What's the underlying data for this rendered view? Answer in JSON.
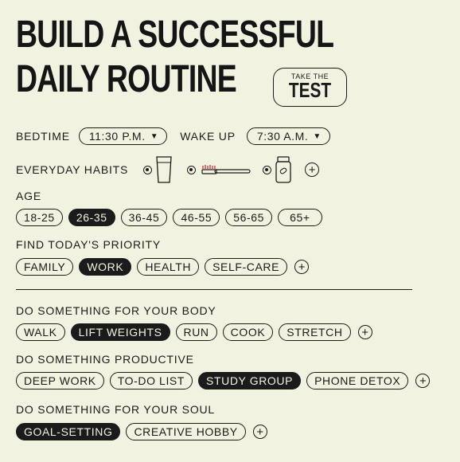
{
  "title": {
    "line1": "BUILD A SUCCESSFUL",
    "line2": "DAILY ROUTINE"
  },
  "test_button": {
    "small": "TAKE THE",
    "big": "TEST"
  },
  "bedtime": {
    "label": "BEDTIME",
    "value": "11:30 P.M."
  },
  "wakeup": {
    "label": "WAKE UP",
    "value": "7:30 A.M."
  },
  "habits": {
    "label": "EVERYDAY HABITS",
    "icons": [
      "glass-of-water-icon",
      "toothbrush-icon",
      "pill-bottle-icon"
    ]
  },
  "age": {
    "label": "AGE",
    "options": [
      "18-25",
      "26-35",
      "36-45",
      "46-55",
      "56-65",
      "65+"
    ],
    "selected": "26-35"
  },
  "priority": {
    "label": "FIND TODAY'S PRIORITY",
    "options": [
      "FAMILY",
      "WORK",
      "HEALTH",
      "SELF-CARE"
    ],
    "selected": "WORK"
  },
  "body": {
    "label": "DO SOMETHING FOR YOUR BODY",
    "options": [
      "WALK",
      "LIFT WEIGHTS",
      "RUN",
      "COOK",
      "STRETCH"
    ],
    "selected": "LIFT WEIGHTS"
  },
  "productive": {
    "label": "DO SOMETHING PRODUCTIVE",
    "options": [
      "DEEP WORK",
      "TO-DO LIST",
      "STUDY GROUP",
      "PHONE DETOX"
    ],
    "selected": "STUDY GROUP"
  },
  "soul": {
    "label": "DO SOMETHING FOR YOUR SOUL",
    "options": [
      "GOAL-SETTING",
      "CREATIVE HOBBY"
    ],
    "selected": "GOAL-SETTING"
  },
  "colors": {
    "background": "#f1f2e0",
    "ink": "#1b1b1b"
  }
}
